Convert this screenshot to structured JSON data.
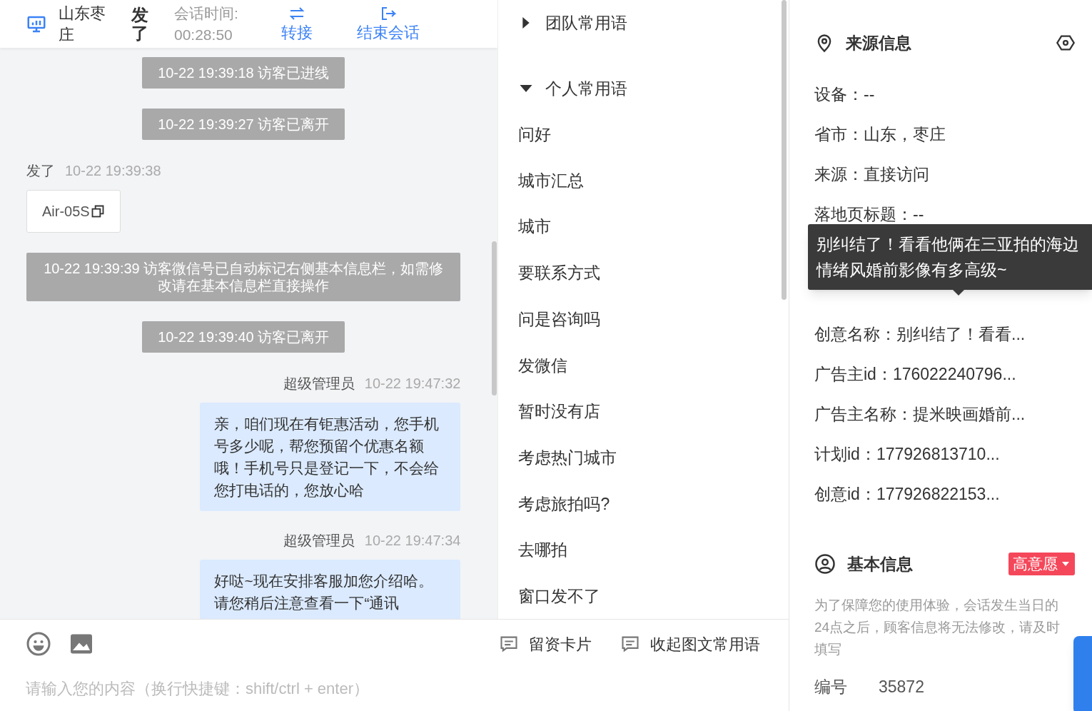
{
  "header": {
    "visitor": "山东枣庄",
    "name": "发了",
    "session_label": "会话时间:",
    "session_time": "00:28:50",
    "actions": [
      {
        "kind": "transfer",
        "label": "转接"
      },
      {
        "kind": "end",
        "label": "结束会话"
      }
    ]
  },
  "messages": [
    {
      "kind": "system",
      "text": "10-22 19:39:18 访客已进线"
    },
    {
      "kind": "system",
      "text": "10-22 19:39:27 访客已离开"
    },
    {
      "kind": "visitor",
      "sender": "发了",
      "time": "10-22 19:39:38",
      "text": "Air-05S"
    },
    {
      "kind": "system",
      "text": "10-22 19:39:39 访客微信号已自动标记右侧基本信息栏，如需修改请在基本信息栏直接操作"
    },
    {
      "kind": "system",
      "text": "10-22 19:39:40 访客已离开"
    },
    {
      "kind": "agent",
      "sender": "超级管理员",
      "time": "10-22 19:47:32",
      "text": "亲，咱们现在有钜惠活动，您手机号多少呢，帮您预留个优惠名额哦！手机号只是登记一下，不会给您打电话的，您放心哈"
    },
    {
      "kind": "agent",
      "sender": "超级管理员",
      "time": "10-22 19:47:34",
      "text": "好哒~现在安排客服加您介绍哈。请您稍后注意查看一下“通讯"
    }
  ],
  "composer": {
    "placeholder": "请输入您的内容（换行快捷键：shift/ctrl + enter）",
    "tools": [
      "留资卡片",
      "收起图文常用语"
    ]
  },
  "phrases": [
    {
      "label": "团队常用语",
      "expanded": false
    },
    {
      "label": "个人常用语",
      "expanded": true,
      "children": [
        "问好",
        "城市汇总",
        "城市",
        "要联系方式",
        "问是咨询吗",
        "发微信",
        "暂时没有店",
        "考虑热门城市",
        "考虑旅拍吗?",
        "去哪拍",
        "窗口发不了"
      ]
    }
  ],
  "source_info": {
    "title": "来源信息",
    "fields": [
      "设备：--",
      "省市：山东，枣庄",
      "来源：直接访问",
      "落地页标题：--",
      "创意名称：别纠结了！看看...",
      "广告主id：176022240796...",
      "广告主名称：提米映画婚前...",
      "计划id：177926813710...",
      "创意id：177926822153..."
    ],
    "tooltip": "别纠结了！看看他俩在三亚拍的海边情绪风婚前影像有多高级~"
  },
  "basic_info": {
    "title": "基本信息",
    "intent": "高意愿",
    "notice": "为了保障您的使用体验，会话发生当日的24点之后，顾客信息将无法修改，请及时填写",
    "number_label": "编号",
    "number": "35872"
  }
}
